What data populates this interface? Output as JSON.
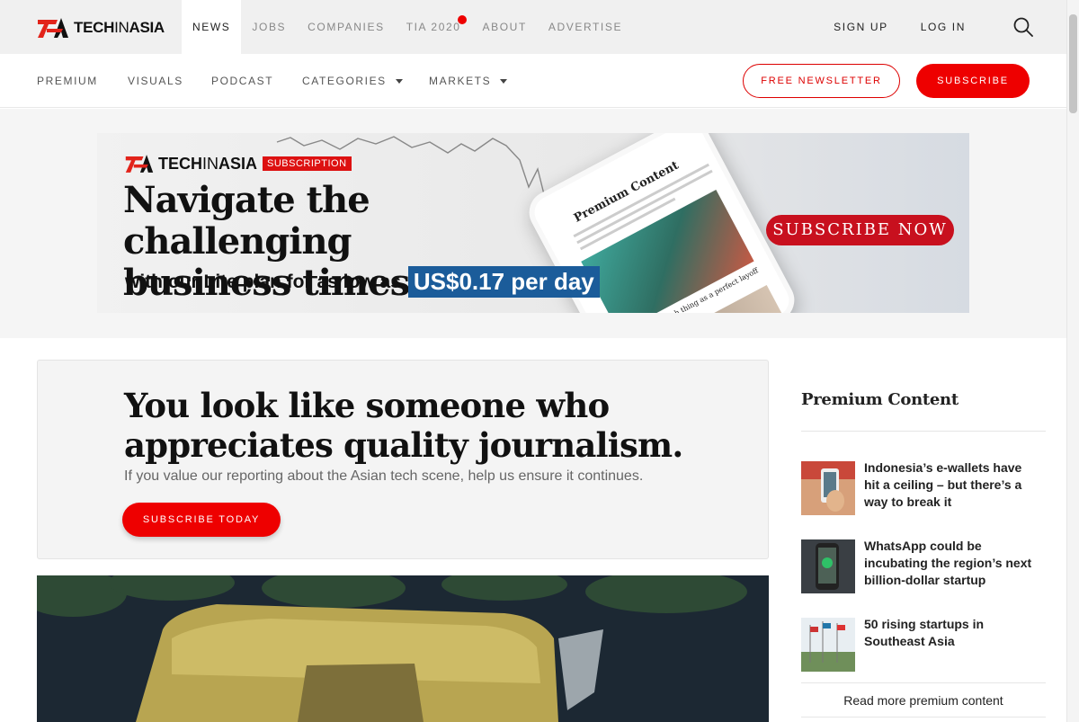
{
  "brand": {
    "name_bold": "TECH",
    "name_mid": "IN",
    "name_end": "ASIA"
  },
  "topnav": {
    "items": [
      {
        "label": "NEWS",
        "active": true
      },
      {
        "label": "JOBS",
        "active": false
      },
      {
        "label": "COMPANIES",
        "active": false
      },
      {
        "label": "TIA 2020",
        "active": false,
        "has_dot": true
      },
      {
        "label": "ABOUT",
        "active": false
      },
      {
        "label": "ADVERTISE",
        "active": false
      }
    ],
    "sign_up": "SIGN UP",
    "log_in": "LOG IN",
    "search_icon": "search-icon"
  },
  "secnav": {
    "premium": "PREMIUM",
    "visuals": "VISUALS",
    "podcast": "PODCAST",
    "categories": "CATEGORIES",
    "markets": "MARKETS",
    "newsletter": "FREE NEWSLETTER",
    "subscribe": "SUBSCRIBE"
  },
  "banner": {
    "brand_bold": "TECH",
    "brand_mid": "IN",
    "brand_end": "ASIA",
    "tag": "SUBSCRIPTION",
    "headline_1": "Navigate the challenging",
    "headline_2": "business times",
    "sub": "with our Lite plan for as low as",
    "price": "US$0.17 per day",
    "cta": "SUBSCRIBE NOW",
    "phone_title": "Premium Content",
    "phone_caption": "There's no such thing as a perfect layoff"
  },
  "promo": {
    "headline_1": "You look like someone who",
    "headline_2": "appreciates quality journalism.",
    "sub": "If you value our reporting about the Asian tech scene, help us ensure it continues.",
    "button": "SUBSCRIBE TODAY"
  },
  "sidebar": {
    "title": "Premium Content",
    "items": [
      {
        "title": "Indonesia’s e-wallets have hit a ceiling – but there’s a way to break it"
      },
      {
        "title": "WhatsApp could be incubating the region’s next billion-dollar startup"
      },
      {
        "title": "50 rising startups in Southeast Asia"
      }
    ],
    "more": "Read more premium content"
  },
  "colors": {
    "accent": "#e00000",
    "price_bg": "#1b5c9a",
    "cta_red": "#c8101e"
  }
}
